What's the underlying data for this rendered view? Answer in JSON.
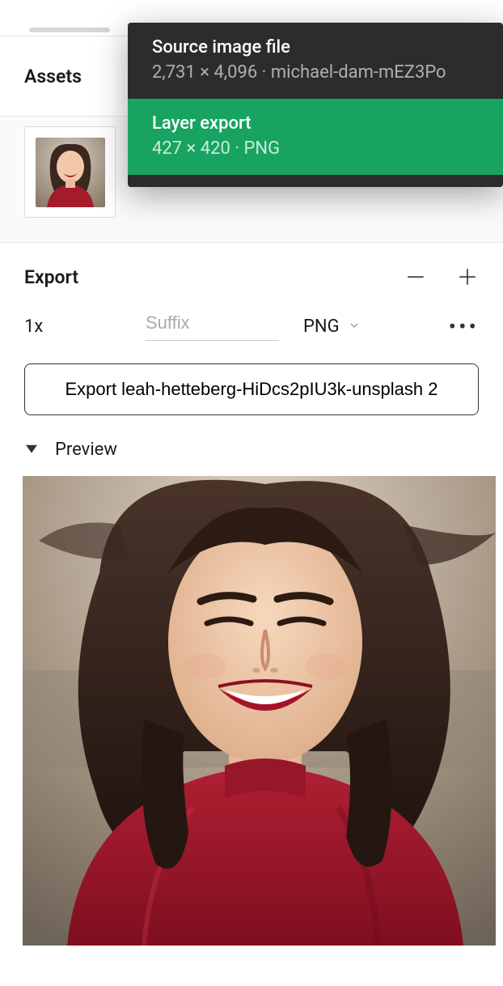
{
  "assets": {
    "title": "Assets"
  },
  "popup": {
    "items": [
      {
        "title": "Source image file",
        "sub": "2,731 × 4,096 · michael-dam-mEZ3Po"
      },
      {
        "title": "Layer export",
        "sub": "427 × 420 · PNG"
      }
    ]
  },
  "export": {
    "title": "Export",
    "scale": "1x",
    "suffix_placeholder": "Suffix",
    "format": "PNG",
    "button": "Export leah-hetteberg-HiDcs2pIU3k-unsplash 2",
    "preview_label": "Preview"
  }
}
